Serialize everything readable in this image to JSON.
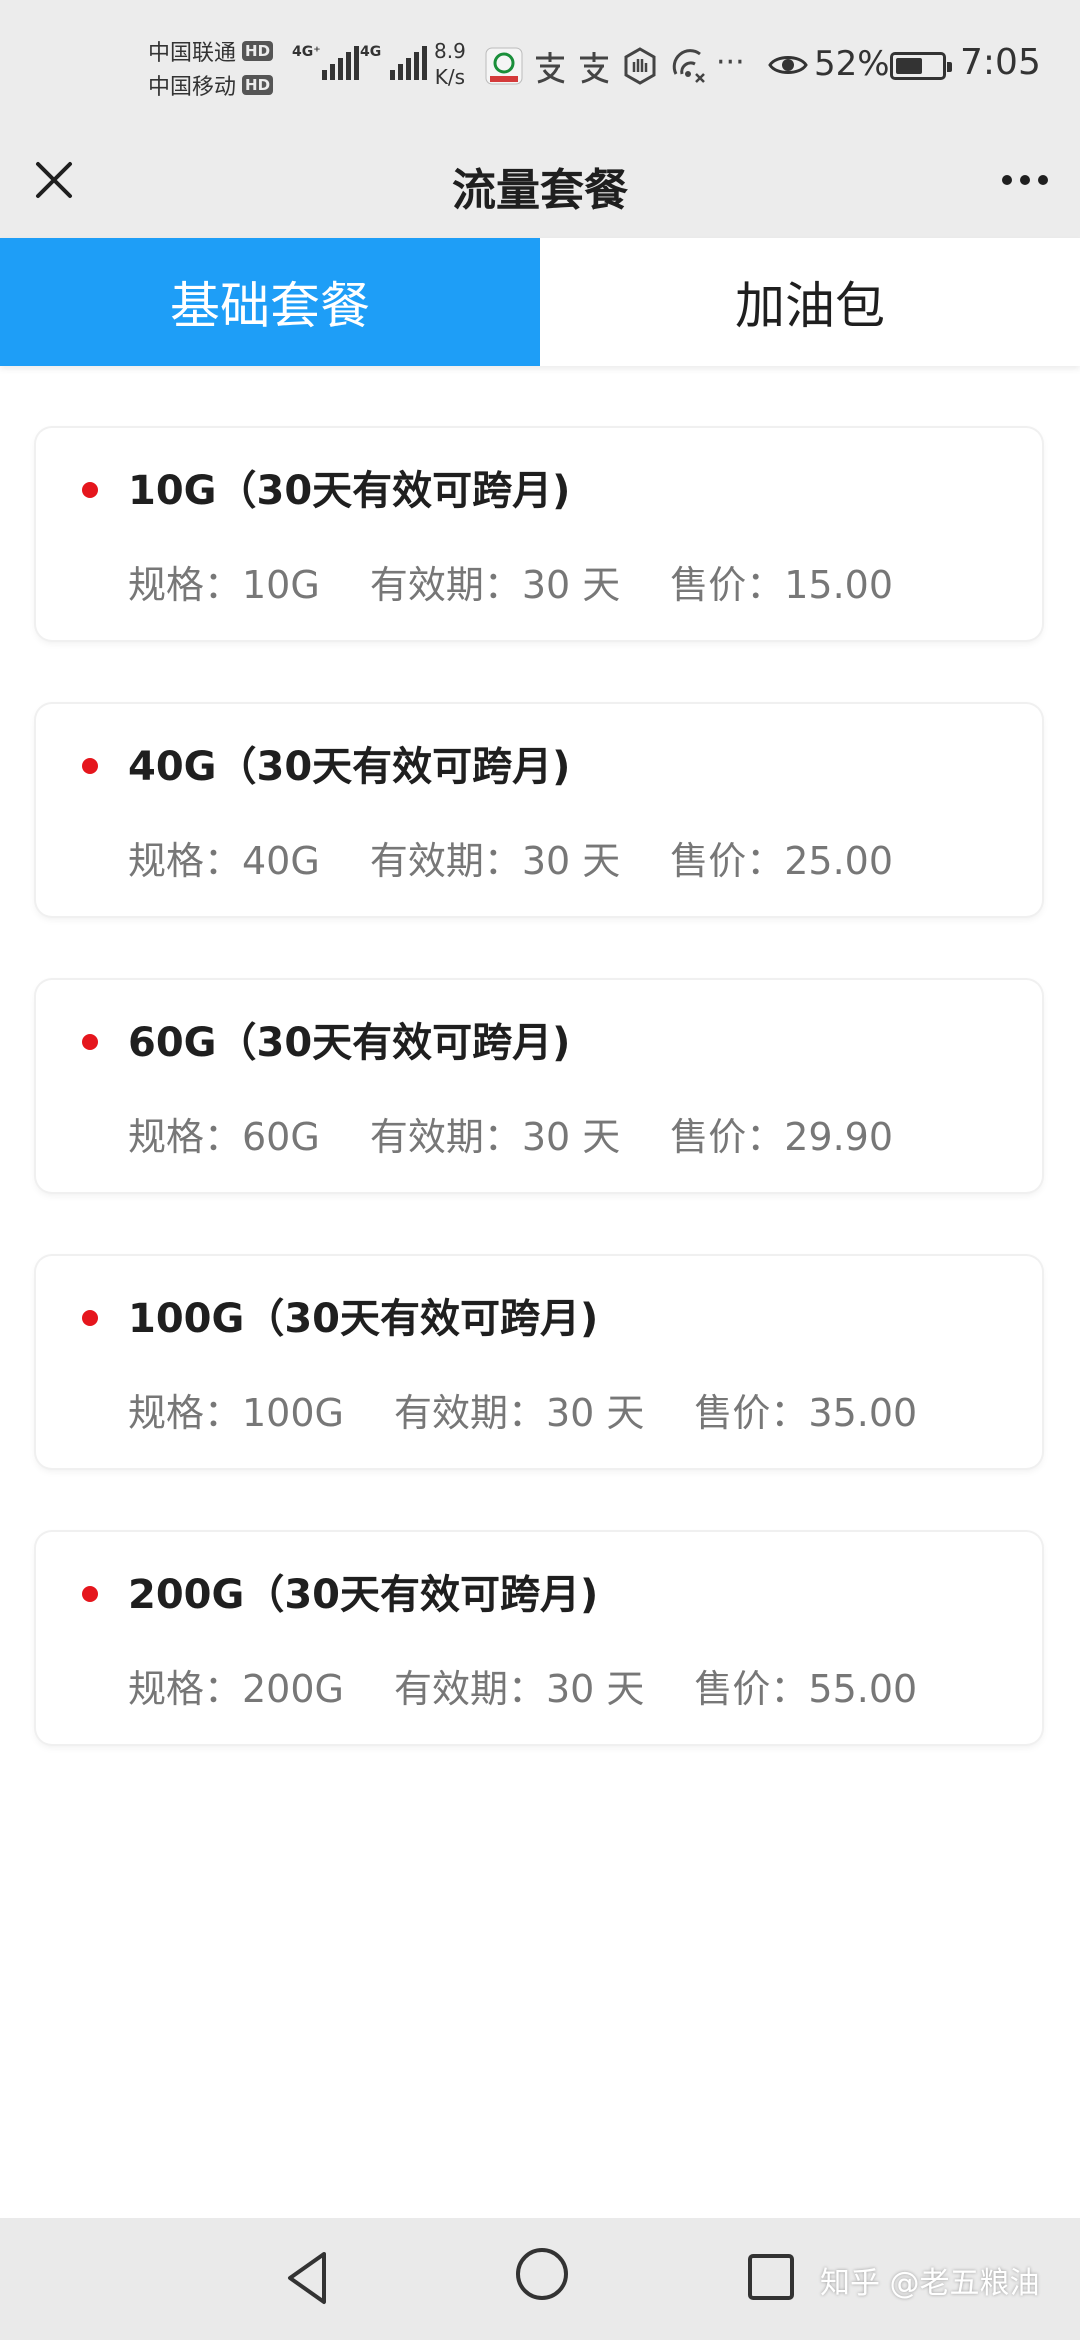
{
  "status_bar": {
    "carrier1": "中国联通",
    "carrier2": "中国移动",
    "hd": "HD",
    "net1": "4G⁺",
    "net2": "4G",
    "speed_value": "8.9",
    "speed_unit": "K/s",
    "more": "···",
    "battery_pct": "52%",
    "battery_level": 0.52,
    "time": "7:05"
  },
  "header": {
    "title": "流量套餐"
  },
  "tabs": [
    {
      "label": "基础套餐",
      "active": true
    },
    {
      "label": "加油包",
      "active": false
    }
  ],
  "plans": [
    {
      "title": "10G（30天有效可跨月)",
      "spec": "规格：10G",
      "validity": "有效期：30 天",
      "price": "售价：15.00"
    },
    {
      "title": "40G（30天有效可跨月)",
      "spec": "规格：40G",
      "validity": "有效期：30 天",
      "price": "售价：25.00"
    },
    {
      "title": "60G（30天有效可跨月)",
      "spec": "规格：60G",
      "validity": "有效期：30 天",
      "price": "售价：29.90"
    },
    {
      "title": "100G（30天有效可跨月)",
      "spec": "规格：100G",
      "validity": "有效期：30 天",
      "price": "售价：35.00"
    },
    {
      "title": "200G（30天有效可跨月)",
      "spec": "规格：200G",
      "validity": "有效期：30 天",
      "price": "售价：55.00"
    }
  ],
  "watermark": "知乎 @老五粮油",
  "colors": {
    "accent": "#1e9ef7",
    "dot": "#e5161d",
    "chrome": "#ececec"
  }
}
